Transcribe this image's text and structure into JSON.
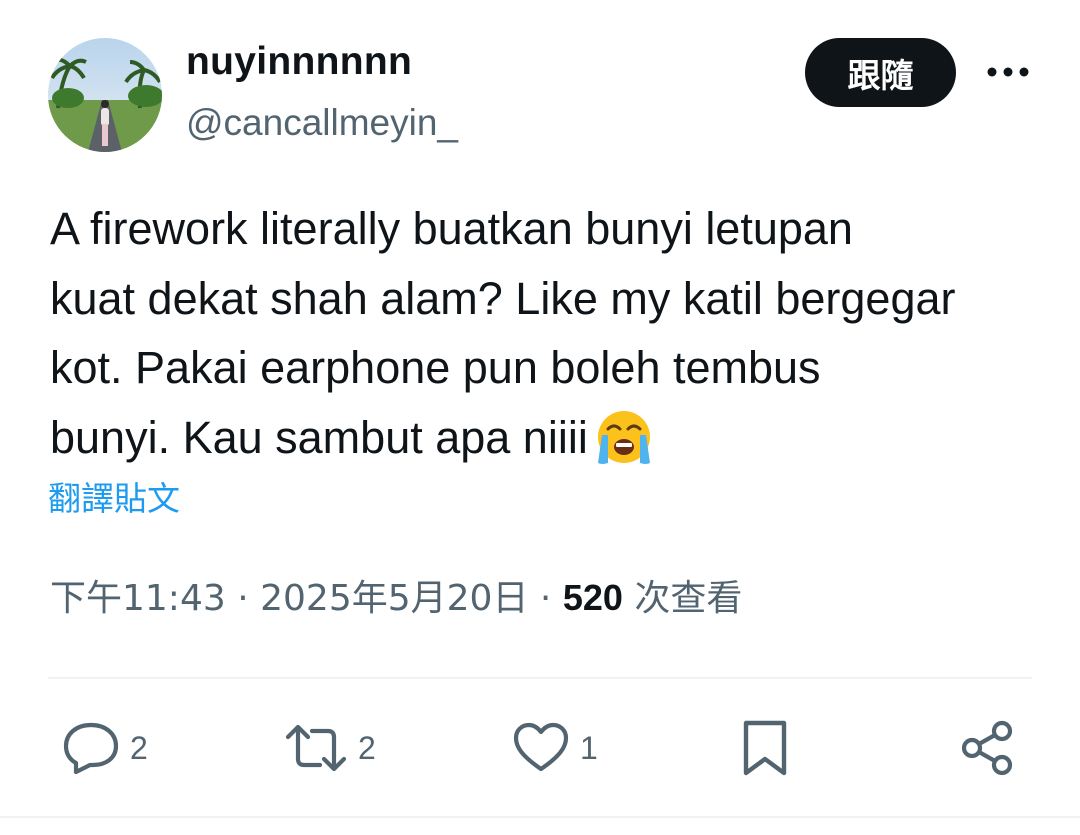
{
  "author": {
    "display_name": "nuyinnnnnn",
    "handle": "@cancallmeyin_"
  },
  "follow_label": "跟隨",
  "tweet": {
    "lines": [
      "A firework literally buatkan bunyi letupan",
      "kuat dekat shah alam? Like my katil bergegar",
      "kot. Pakai earphone pun boleh tembus",
      "bunyi. Kau sambut apa niiii"
    ],
    "emoji": "loudly-crying-face"
  },
  "translate_label": "翻譯貼文",
  "meta": {
    "time": "下午11:43",
    "separator": "·",
    "date": "2025年5月20日",
    "views_count": "520",
    "views_label": "次查看"
  },
  "actions": {
    "replies": "2",
    "reposts": "2",
    "likes": "1"
  },
  "icons": {
    "reply": "reply-icon",
    "repost": "repost-icon",
    "like": "heart-icon",
    "bookmark": "bookmark-icon",
    "share": "share-icon",
    "more": "more-icon"
  },
  "colors": {
    "text": "#0f1419",
    "secondary": "#536471",
    "link": "#1d9bf0",
    "follow_bg": "#0f1419"
  }
}
